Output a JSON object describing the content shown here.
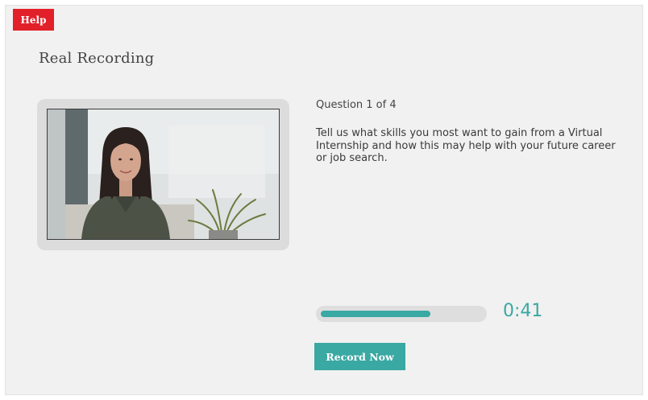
{
  "help": {
    "label": "Help",
    "color": "#e2202a"
  },
  "page": {
    "title": "Real Recording"
  },
  "question": {
    "counter": "Question 1 of 4",
    "text": "Tell us what skills you most want to gain from a Virtual Internship and how this may help with your future career or job search."
  },
  "recording": {
    "progress_fraction": 0.68,
    "timer": "0:41",
    "record_label": "Record Now",
    "accent_color": "#3aa8a3"
  }
}
